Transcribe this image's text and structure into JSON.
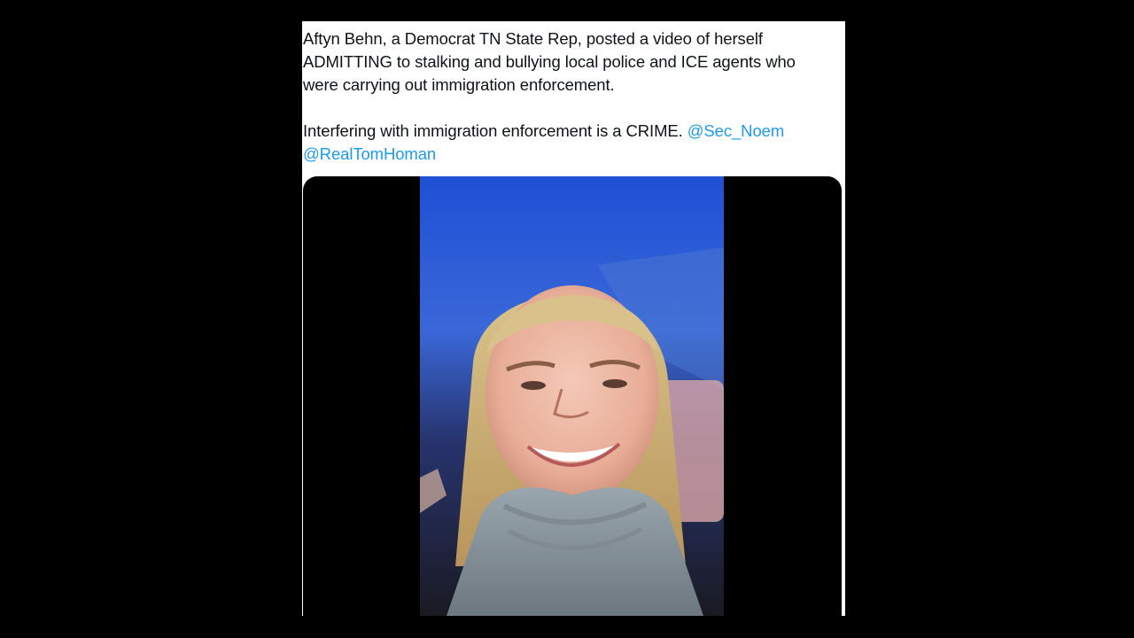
{
  "tweet": {
    "paragraph1": "Aftyn Behn, a Democrat TN State Rep, posted a video of herself ADMITTING to stalking and bullying local police and ICE agents who were carrying out immigration enforcement.",
    "paragraph2_text": "Interfering with immigration enforcement is a CRIME.",
    "mentions": [
      "@Sec_Noem",
      "@RealTomHoman"
    ]
  },
  "media": {
    "type": "video",
    "icon": "video-player-icon"
  },
  "colors": {
    "background": "#000000",
    "card": "#ffffff",
    "text": "#0f1419",
    "mention": "#1d9bf0"
  }
}
